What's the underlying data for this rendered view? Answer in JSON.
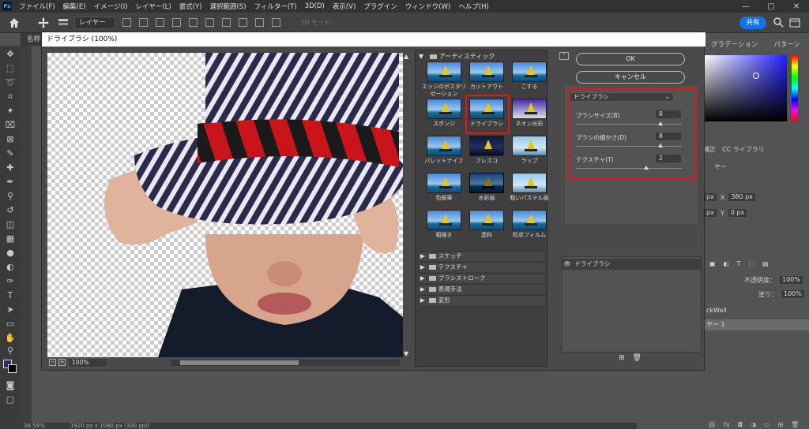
{
  "menubar": {
    "logo": "Ps",
    "items": [
      "ファイル(F)",
      "編集(E)",
      "イメージ(I)",
      "レイヤー(L)",
      "書式(Y)",
      "選択範囲(S)",
      "フィルター(T)",
      "3D(D)",
      "表示(V)",
      "プラグイン",
      "ウィンドウ(W)",
      "ヘルプ(H)"
    ],
    "window_controls": [
      "—",
      "□",
      "✕"
    ]
  },
  "options_bar": {
    "layer_select_label": "レイヤー",
    "mode_3d_label": "3D モード：",
    "share_label": "共有"
  },
  "document": {
    "tab_label": "名称",
    "status_zoom": "36.58%",
    "status_dims": "1920 px x 1080 px (300 ppi)"
  },
  "filter_gallery": {
    "title": "ドライブラシ (100%)",
    "preview_zoom": "100%",
    "zoom_out": "−",
    "zoom_in": "+",
    "category_open": "アーティスティック",
    "thumbnails": [
      {
        "label": "エッジのポスタリゼーション",
        "style": "normal"
      },
      {
        "label": "カットアウト",
        "style": "normal"
      },
      {
        "label": "こする",
        "style": "normal"
      },
      {
        "label": "スポンジ",
        "style": "normal"
      },
      {
        "label": "ドライブラシ",
        "style": "normal",
        "selected": true
      },
      {
        "label": "ネオン光彩",
        "style": "neon"
      },
      {
        "label": "パレットナイフ",
        "style": "normal"
      },
      {
        "label": "フレスコ",
        "style": "fresco"
      },
      {
        "label": "ラップ",
        "style": "light"
      },
      {
        "label": "色鉛筆",
        "style": "normal"
      },
      {
        "label": "水彩画",
        "style": "dark"
      },
      {
        "label": "粗いパステル画",
        "style": "light"
      },
      {
        "label": "粗描き",
        "style": "normal"
      },
      {
        "label": "塗料",
        "style": "normal"
      },
      {
        "label": "粒状フィルム",
        "style": "normal"
      }
    ],
    "collapsed_categories": [
      "スケッチ",
      "テクスチャ",
      "ブラシストローク",
      "表現手法",
      "変形"
    ],
    "ok_label": "OK",
    "cancel_label": "キャンセル",
    "filter_dropdown": "ドライブラシ",
    "params": [
      {
        "label": "ブラシサイズ(B)",
        "value": "8",
        "max": 10
      },
      {
        "label": "ブラシの細かさ(D)",
        "value": "8",
        "max": 10
      },
      {
        "label": "テクスチャ(T)",
        "value": "2",
        "max": 3
      }
    ],
    "effect_layer_label": "ドライブラシ"
  },
  "right_panel": {
    "tabs": [
      "グラデーション",
      "パターン"
    ],
    "tabs2": [
      "補正",
      "CC ライブラリ"
    ],
    "section_label": "ヤー",
    "x_label": "X",
    "x_value": "380 px",
    "y_label": "Y",
    "y_value": "0 px",
    "px_left_1": "px",
    "px_left_2": "px",
    "opacity_label": "不透明度：",
    "opacity_value": "100%",
    "fill_label": "塗り：",
    "fill_value": "100%",
    "layers": [
      "ckWall",
      "ヤー 1"
    ]
  },
  "colors": {
    "accent_red": "#e0161c",
    "share_blue": "#1473e6",
    "foreground_color": "#27287a"
  }
}
